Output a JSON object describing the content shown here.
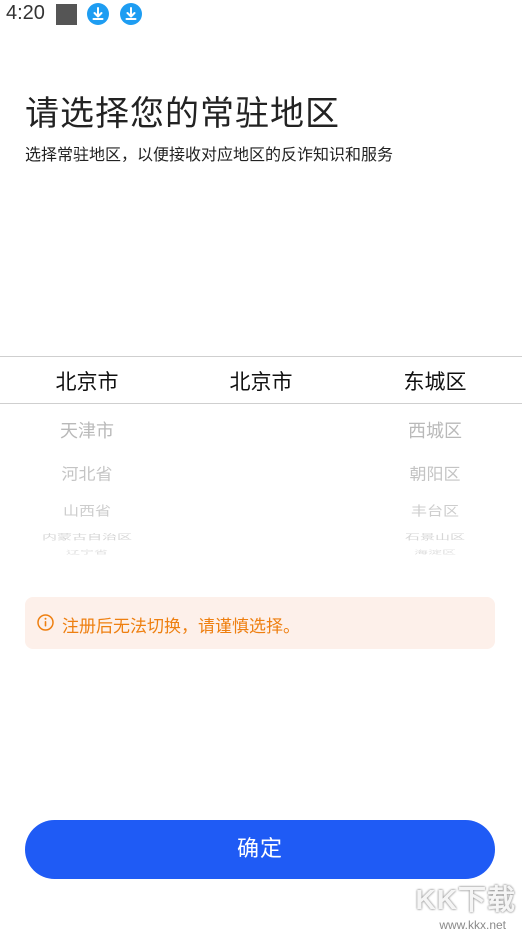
{
  "status_bar": {
    "time": "4:20",
    "icons": [
      "notification-square-icon",
      "download-icon",
      "download-icon"
    ]
  },
  "header": {
    "title": "请选择您的常驻地区",
    "subtitle": "选择常驻地区，以便接收对应地区的反诈知识和服务"
  },
  "picker": {
    "province": {
      "selected": "北京市",
      "following": [
        "天津市",
        "河北省",
        "山西省",
        "内蒙古自治区",
        "辽宁省"
      ]
    },
    "city": {
      "selected": "北京市",
      "following": []
    },
    "district": {
      "selected": "东城区",
      "following": [
        "西城区",
        "朝阳区",
        "丰台区",
        "石景山区",
        "海淀区"
      ]
    }
  },
  "warning": {
    "icon": "info-icon",
    "text": "注册后无法切换，请谨慎选择。",
    "color": "#ee7f10",
    "background": "#fdf0ea"
  },
  "confirm_button": {
    "label": "确定",
    "color": "#1f5bf5"
  },
  "watermark": {
    "logo": "KK下载",
    "url": "www.kkx.net"
  }
}
